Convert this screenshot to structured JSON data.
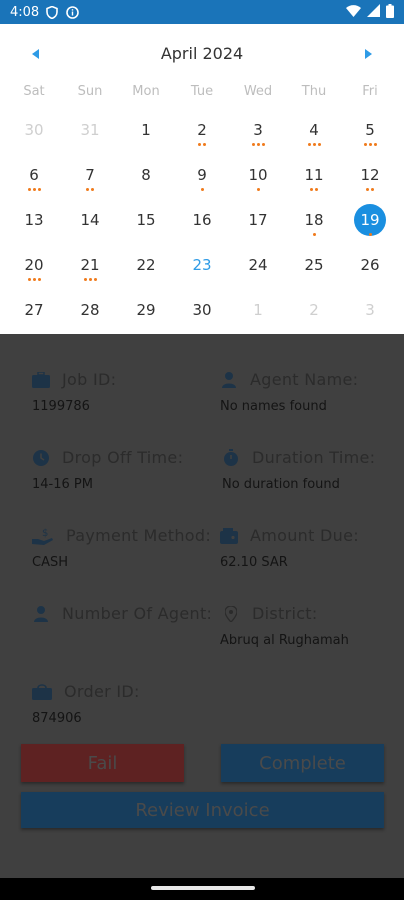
{
  "status_bar": {
    "time": "4:08",
    "icons": [
      "shield-icon",
      "info-icon"
    ],
    "right_icons": [
      "wifi-icon",
      "signal-icon",
      "battery-icon"
    ]
  },
  "calendar": {
    "title": "April 2024",
    "prev_icon": "chevron-left-icon",
    "next_icon": "chevron-right-icon",
    "weekdays": [
      "Sat",
      "Sun",
      "Mon",
      "Tue",
      "Wed",
      "Thu",
      "Fri"
    ],
    "weeks": [
      [
        {
          "d": "30",
          "other": true,
          "dots": 0
        },
        {
          "d": "31",
          "other": true,
          "dots": 0
        },
        {
          "d": "1",
          "dots": 0
        },
        {
          "d": "2",
          "dots": 2
        },
        {
          "d": "3",
          "dots": 3
        },
        {
          "d": "4",
          "dots": 3
        },
        {
          "d": "5",
          "dots": 3
        }
      ],
      [
        {
          "d": "6",
          "dots": 3
        },
        {
          "d": "7",
          "dots": 2
        },
        {
          "d": "8",
          "dots": 0
        },
        {
          "d": "9",
          "dots": 1
        },
        {
          "d": "10",
          "dots": 1
        },
        {
          "d": "11",
          "dots": 2
        },
        {
          "d": "12",
          "dots": 2
        }
      ],
      [
        {
          "d": "13",
          "dots": 0
        },
        {
          "d": "14",
          "dots": 0
        },
        {
          "d": "15",
          "dots": 0
        },
        {
          "d": "16",
          "dots": 0
        },
        {
          "d": "17",
          "dots": 0
        },
        {
          "d": "18",
          "dots": 1
        },
        {
          "d": "19",
          "dots": 1,
          "selected": true
        }
      ],
      [
        {
          "d": "20",
          "dots": 3
        },
        {
          "d": "21",
          "dots": 3
        },
        {
          "d": "22",
          "dots": 0
        },
        {
          "d": "23",
          "dots": 0,
          "today": true
        },
        {
          "d": "24",
          "dots": 0
        },
        {
          "d": "25",
          "dots": 0
        },
        {
          "d": "26",
          "dots": 0
        }
      ],
      [
        {
          "d": "27",
          "dots": 0
        },
        {
          "d": "28",
          "dots": 0
        },
        {
          "d": "29",
          "dots": 0
        },
        {
          "d": "30",
          "dots": 0
        },
        {
          "d": "1",
          "other": true,
          "dots": 0
        },
        {
          "d": "2",
          "other": true,
          "dots": 0
        },
        {
          "d": "3",
          "other": true,
          "dots": 0
        }
      ]
    ],
    "colors": {
      "selected": "#1a8fe0",
      "today": "#2e9be6",
      "dot": "#f07a1c"
    }
  },
  "details": {
    "job_id": {
      "label": "Job ID:",
      "value": "1199786",
      "icon": "briefcase-icon"
    },
    "agent_name": {
      "label": "Agent Name:",
      "value": "No names found",
      "icon": "person-icon"
    },
    "drop_off_time": {
      "label": "Drop Off Time:",
      "value": "14-16 PM",
      "icon": "clock-icon"
    },
    "duration_time": {
      "label": "Duration Time:",
      "value": "No duration found",
      "icon": "stopwatch-icon"
    },
    "payment_method": {
      "label": "Payment Method:",
      "value": "CASH",
      "icon": "cash-hand-icon"
    },
    "amount_due": {
      "label": "Amount Due:",
      "value": "62.10 SAR",
      "icon": "wallet-icon"
    },
    "number_of_agent": {
      "label": "Number Of Agent:",
      "value": "",
      "icon": "person-icon"
    },
    "district": {
      "label": "District:",
      "value": "Abruq al Rughamah",
      "icon": "location-pin-icon"
    },
    "order_id": {
      "label": "Order ID:",
      "value": "874906",
      "icon": "shopping-bag-icon"
    }
  },
  "actions": {
    "fail_label": "Fail",
    "complete_label": "Complete",
    "review_invoice_label": "Review Invoice",
    "colors": {
      "fail": "#5e2222",
      "primary": "#173d5c"
    }
  }
}
